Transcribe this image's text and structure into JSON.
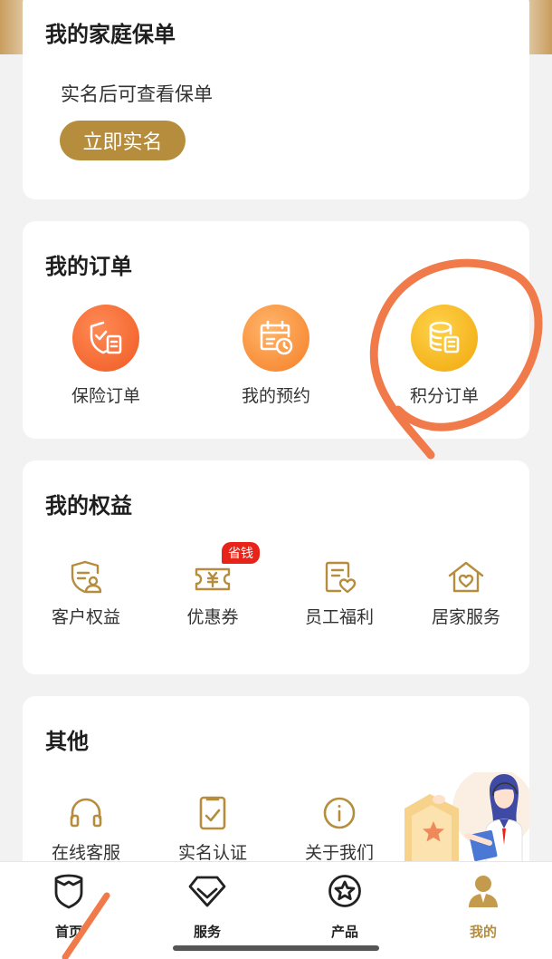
{
  "policy": {
    "title": "我的家庭保单",
    "hint": "实名后可查看保单",
    "verify_button": "立即实名"
  },
  "orders": {
    "title": "我的订单",
    "items": [
      {
        "label": "保险订单",
        "icon": "shield-document-icon"
      },
      {
        "label": "我的预约",
        "icon": "calendar-clock-icon"
      },
      {
        "label": "积分订单",
        "icon": "coins-document-icon"
      }
    ]
  },
  "rights": {
    "title": "我的权益",
    "items": [
      {
        "label": "客户权益",
        "icon": "shield-user-icon"
      },
      {
        "label": "优惠券",
        "icon": "coupon-icon",
        "badge": "省钱"
      },
      {
        "label": "员工福利",
        "icon": "document-heart-icon"
      },
      {
        "label": "居家服务",
        "icon": "house-heart-icon"
      }
    ]
  },
  "others": {
    "title": "其他",
    "items": [
      {
        "label": "在线客服",
        "icon": "headset-icon"
      },
      {
        "label": "实名认证",
        "icon": "id-check-icon"
      },
      {
        "label": "关于我们",
        "icon": "info-icon"
      }
    ]
  },
  "tabbar": {
    "items": [
      {
        "label": "首页",
        "icon": "home-shield-icon"
      },
      {
        "label": "服务",
        "icon": "diamond-icon"
      },
      {
        "label": "产品",
        "icon": "star-circle-icon"
      },
      {
        "label": "我的",
        "icon": "person-icon",
        "active": true
      }
    ]
  },
  "colors": {
    "accent": "#b58d3c",
    "badge_red": "#e8241a",
    "annotation": "#f07a4a"
  }
}
